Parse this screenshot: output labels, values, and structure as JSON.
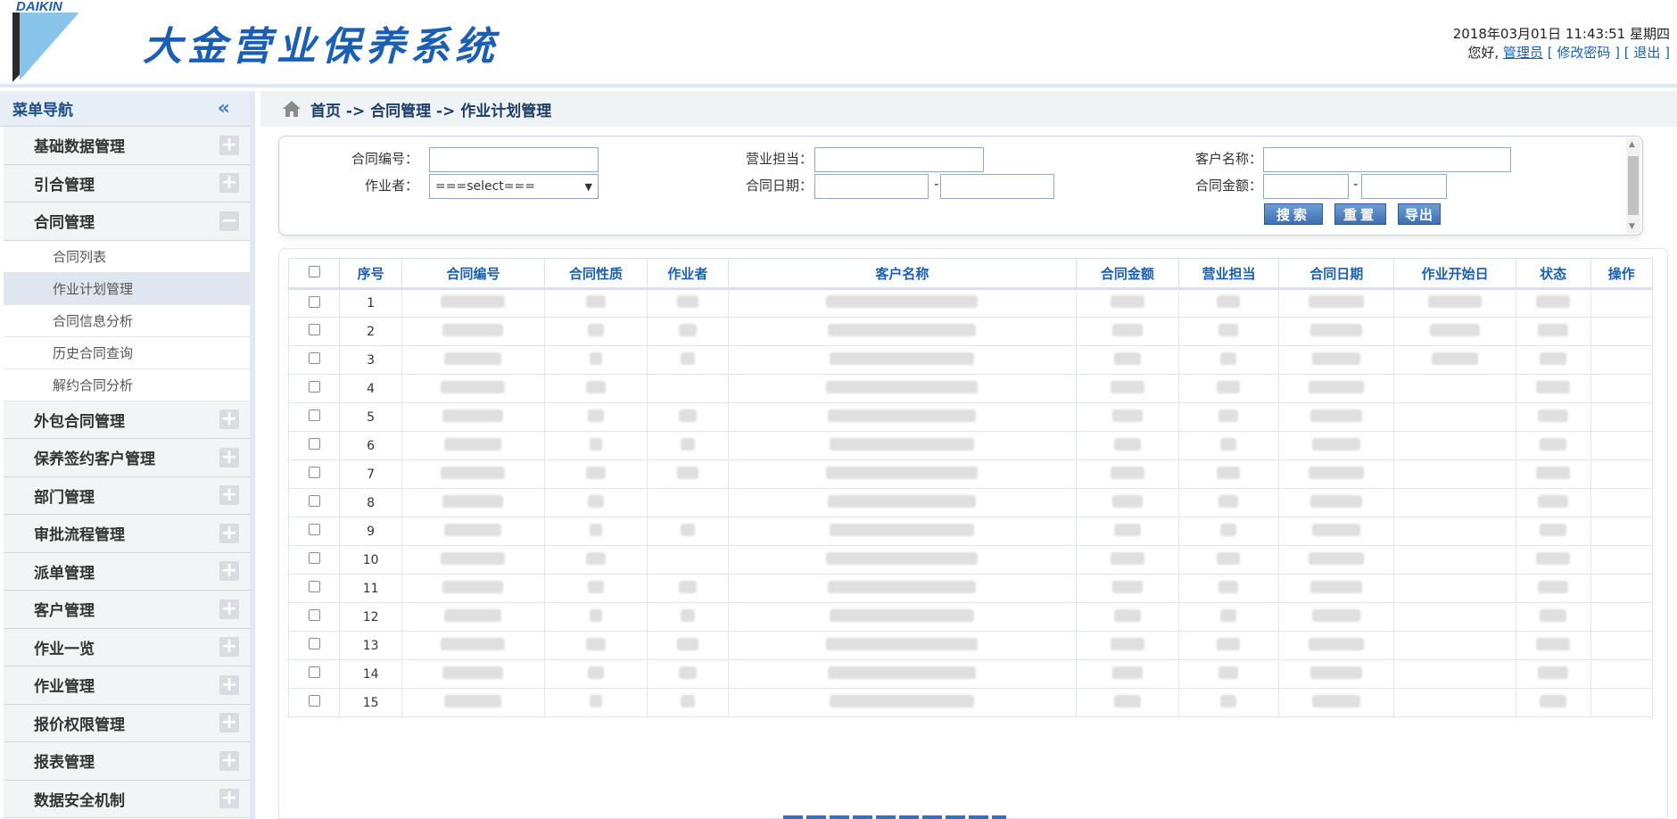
{
  "header": {
    "logo_text": "DAIKIN",
    "title": "大金营业保养系统",
    "datetime": "2018年03月01日 11:43:51 星期四",
    "greeting": "您好,",
    "user": "管理员",
    "change_password": "[ 修改密码 ]",
    "logout": "[ 退出 ]"
  },
  "sidebar": {
    "title": "菜单导航",
    "collapse_icon": "«",
    "groups": [
      {
        "label": "基础数据管理",
        "expanded": false
      },
      {
        "label": "引合管理",
        "expanded": false
      },
      {
        "label": "合同管理",
        "expanded": true,
        "items": [
          "合同列表",
          "作业计划管理",
          "合同信息分析",
          "历史合同查询",
          "解约合同分析"
        ],
        "active": "作业计划管理"
      },
      {
        "label": "外包合同管理",
        "expanded": false
      },
      {
        "label": "保养签约客户管理",
        "expanded": false
      },
      {
        "label": "部门管理",
        "expanded": false
      },
      {
        "label": "审批流程管理",
        "expanded": false
      },
      {
        "label": "派单管理",
        "expanded": false
      },
      {
        "label": "客户管理",
        "expanded": false
      },
      {
        "label": "作业一览",
        "expanded": false
      },
      {
        "label": "作业管理",
        "expanded": false
      },
      {
        "label": "报价权限管理",
        "expanded": false
      },
      {
        "label": "报表管理",
        "expanded": false
      },
      {
        "label": "数据安全机制",
        "expanded": false
      }
    ]
  },
  "breadcrumb": "首页 -> 合同管理 -> 作业计划管理",
  "search": {
    "contract_no_label": "合同编号：",
    "sales_label": "营业担当：",
    "customer_label": "客户名称：",
    "worker_label": "作业者：",
    "worker_value": "===select===",
    "date_label": "合同日期：",
    "amount_label": "合同金额：",
    "dash": "-",
    "search_btn": "搜索",
    "reset_btn": "重置",
    "export_btn": "导出"
  },
  "table": {
    "headers": [
      "序号",
      "合同编号",
      "合同性质",
      "作业者",
      "客户名称",
      "合同金额",
      "营业担当",
      "合同日期",
      "作业开始日",
      "状态",
      "操作"
    ],
    "row_numbers": [
      "1",
      "2",
      "3",
      "4",
      "5",
      "6",
      "7",
      "8",
      "9",
      "10",
      "11",
      "12",
      "13",
      "14",
      "15"
    ]
  },
  "colors": {
    "accent": "#1a5fb4",
    "sidebar_bg": "#f2f4f6",
    "active_item": "#dfe6ef"
  }
}
